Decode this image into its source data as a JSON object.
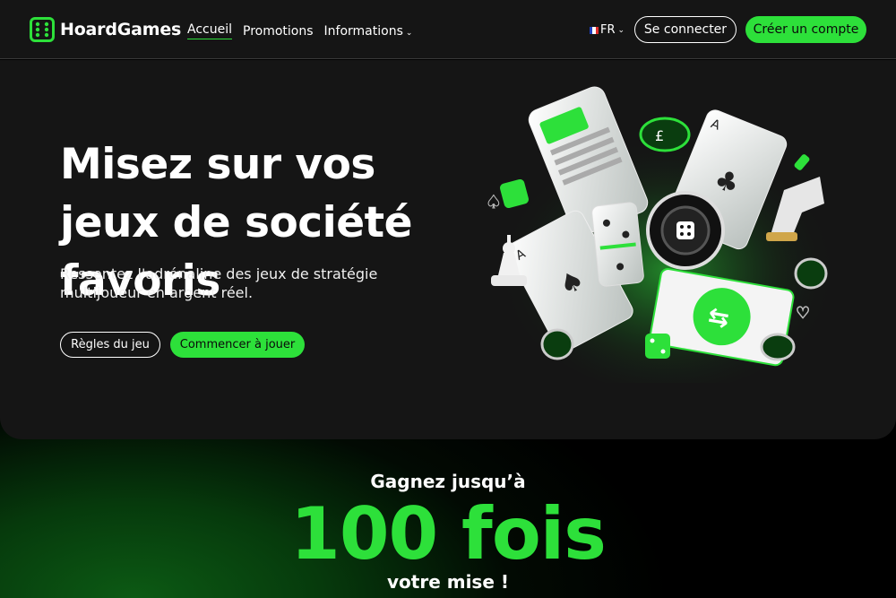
{
  "brand": {
    "name": "HoardGames",
    "accent_color": "#2de03a"
  },
  "nav": {
    "items": [
      {
        "label": "Accueil",
        "active": true
      },
      {
        "label": "Promotions",
        "active": false
      },
      {
        "label": "Informations",
        "active": false,
        "icon": "chevron-down-icon"
      }
    ]
  },
  "language": {
    "label": "FR",
    "icon": "flag-fr-icon"
  },
  "header_actions": {
    "login_label": "Se connecter",
    "signup_label": "Créer un compte"
  },
  "hero": {
    "title": "Misez sur vos jeux de société favoris",
    "subtitle": "Ressentez l'adrénaline des jeux de stratégie multijoueur en argent réel.",
    "rules_label": "Règles du jeu",
    "start_label": "Commencer à jouer"
  },
  "win": {
    "line1": "Gagnez jusqu’à",
    "big": "100 fois",
    "line3": "votre mise !"
  }
}
